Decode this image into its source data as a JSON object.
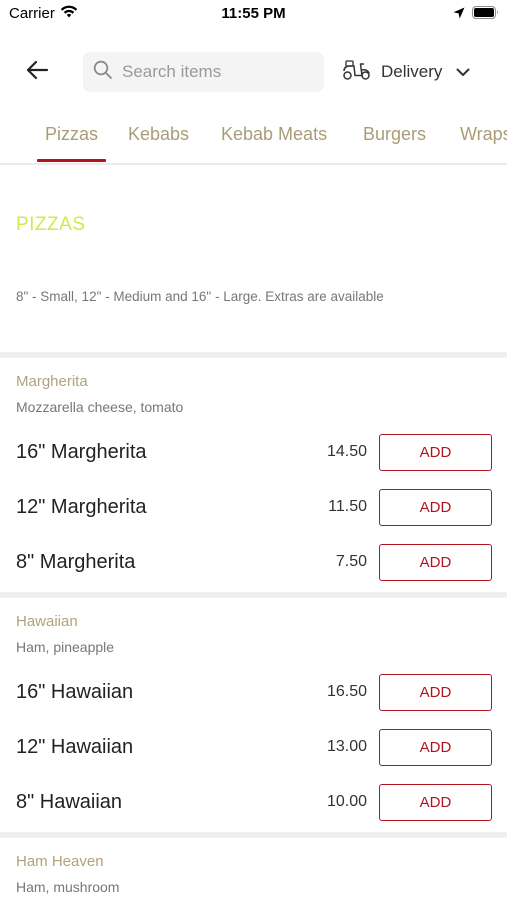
{
  "status_bar": {
    "carrier": "Carrier",
    "time": "11:55 PM"
  },
  "header": {
    "search_placeholder": "Search items",
    "delivery_label": "Delivery"
  },
  "tabs": [
    {
      "label": "Pizzas",
      "selected": true
    },
    {
      "label": "Kebabs",
      "selected": false
    },
    {
      "label": "Kebab Meats",
      "selected": false
    },
    {
      "label": "Burgers",
      "selected": false
    },
    {
      "label": "Wraps",
      "selected": false
    }
  ],
  "section": {
    "title": "PIZZAS",
    "description": "8\" - Small, 12\" - Medium and 16\" - Large. Extras are available"
  },
  "groups": [
    {
      "name": "Margherita",
      "description": "Mozzarella cheese, tomato",
      "items": [
        {
          "name": "16\" Margherita",
          "price": "14.50",
          "action": "ADD"
        },
        {
          "name": "12\" Margherita",
          "price": "11.50",
          "action": "ADD"
        },
        {
          "name": "8\" Margherita",
          "price": "7.50",
          "action": "ADD"
        }
      ]
    },
    {
      "name": "Hawaiian",
      "description": "Ham, pineapple",
      "items": [
        {
          "name": "16\" Hawaiian",
          "price": "16.50",
          "action": "ADD"
        },
        {
          "name": "12\" Hawaiian",
          "price": "13.00",
          "action": "ADD"
        },
        {
          "name": "8\" Hawaiian",
          "price": "10.00",
          "action": "ADD"
        }
      ]
    },
    {
      "name": "Ham Heaven",
      "description": "Ham, mushroom",
      "items": []
    }
  ],
  "colors": {
    "accent": "#b0141e",
    "section_title": "#d3e84a",
    "tab_text": "#a89d78",
    "group_name": "#b3a17a"
  },
  "icons": [
    "wifi-icon",
    "location-arrow-icon",
    "battery-icon",
    "back-arrow-icon",
    "search-icon",
    "scooter-icon",
    "chevron-down-icon"
  ]
}
